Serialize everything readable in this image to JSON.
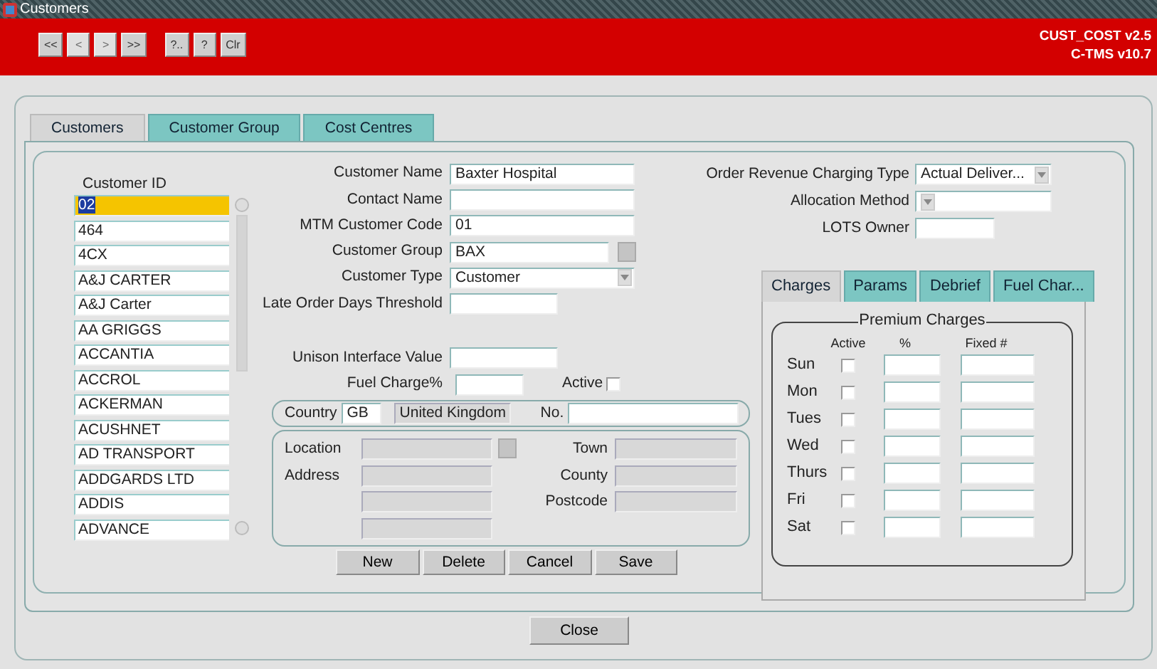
{
  "window": {
    "title": "Customers"
  },
  "toolbar": {
    "buttons": [
      {
        "label": "<<",
        "disabled": false
      },
      {
        "label": "<",
        "disabled": true
      },
      {
        "label": ">",
        "disabled": true
      },
      {
        "label": ">>",
        "disabled": false
      },
      {
        "label": "?..",
        "disabled": false
      },
      {
        "label": "?",
        "disabled": false
      },
      {
        "label": "Clr",
        "disabled": false
      }
    ],
    "version_lines": [
      "CUST_COST v2.5",
      "C-TMS v10.7"
    ]
  },
  "tabs": [
    {
      "label": "Customers",
      "selected": true
    },
    {
      "label": "Customer Group",
      "selected": false
    },
    {
      "label": "Cost Centres",
      "selected": false
    }
  ],
  "customer_list": {
    "label": "Customer ID",
    "items": [
      {
        "text": "02",
        "selected": true
      },
      {
        "text": "464",
        "selected": false
      },
      {
        "text": "4CX",
        "selected": false
      },
      {
        "text": "A&J CARTER",
        "selected": false
      },
      {
        "text": "A&J Carter",
        "selected": false
      },
      {
        "text": "AA GRIGGS",
        "selected": false
      },
      {
        "text": "ACCANTIA",
        "selected": false
      },
      {
        "text": "ACCROL",
        "selected": false
      },
      {
        "text": "ACKERMAN",
        "selected": false
      },
      {
        "text": "ACUSHNET",
        "selected": false
      },
      {
        "text": "AD TRANSPORT",
        "selected": false
      },
      {
        "text": "ADDGARDS LTD",
        "selected": false
      },
      {
        "text": "ADDIS",
        "selected": false
      },
      {
        "text": "ADVANCE",
        "selected": false
      }
    ]
  },
  "fields": [
    {
      "label": "Customer Name",
      "value": "Baxter Hospital",
      "kind": "text"
    },
    {
      "label": "Contact Name",
      "kind": "text"
    },
    {
      "label": "MTM Customer Code",
      "value": "01",
      "kind": "text"
    },
    {
      "label": "Customer Group",
      "value": "BAX",
      "kind": "lookup"
    },
    {
      "label": "Customer Type",
      "value": "Customer",
      "kind": "select"
    },
    {
      "label": "Late Order Days Threshold",
      "kind": "short"
    }
  ],
  "lower_fields": [
    {
      "label": "Unison Interface Value",
      "kind": "short"
    },
    {
      "label": "Fuel Charge%",
      "kind": "tiny"
    }
  ],
  "fuel_active": {
    "label": "Active",
    "checked": false
  },
  "address": {
    "country_label": "Country",
    "country_code": "GB",
    "country_name": "United Kingdom",
    "no_label": "No.",
    "left_labels": [
      "Location",
      "Address"
    ],
    "right_labels": [
      "Town",
      "County",
      "Postcode"
    ]
  },
  "actions": [
    "New",
    "Delete",
    "Cancel",
    "Save"
  ],
  "right_fields": [
    {
      "label": "Order Revenue Charging Type",
      "value": "Actual Deliver...",
      "kind": "select"
    },
    {
      "label": "Allocation Method",
      "kind": "select"
    },
    {
      "label": "LOTS Owner",
      "kind": "short"
    }
  ],
  "sub_tabs": [
    {
      "label": "Charges",
      "selected": true
    },
    {
      "label": "Params",
      "selected": false
    },
    {
      "label": "Debrief",
      "selected": false
    },
    {
      "label": "Fuel Char...",
      "selected": false
    }
  ],
  "premium_charges": {
    "title": "Premium Charges",
    "columns": [
      "Active",
      "%",
      "Fixed #"
    ],
    "rows": [
      {
        "day": "Sun",
        "active": false
      },
      {
        "day": "Mon",
        "active": false
      },
      {
        "day": "Tues",
        "active": false
      },
      {
        "day": "Wed",
        "active": false
      },
      {
        "day": "Thurs",
        "active": false
      },
      {
        "day": "Fri",
        "active": false
      },
      {
        "day": "Sat",
        "active": false
      }
    ]
  },
  "close_button": "Close"
}
